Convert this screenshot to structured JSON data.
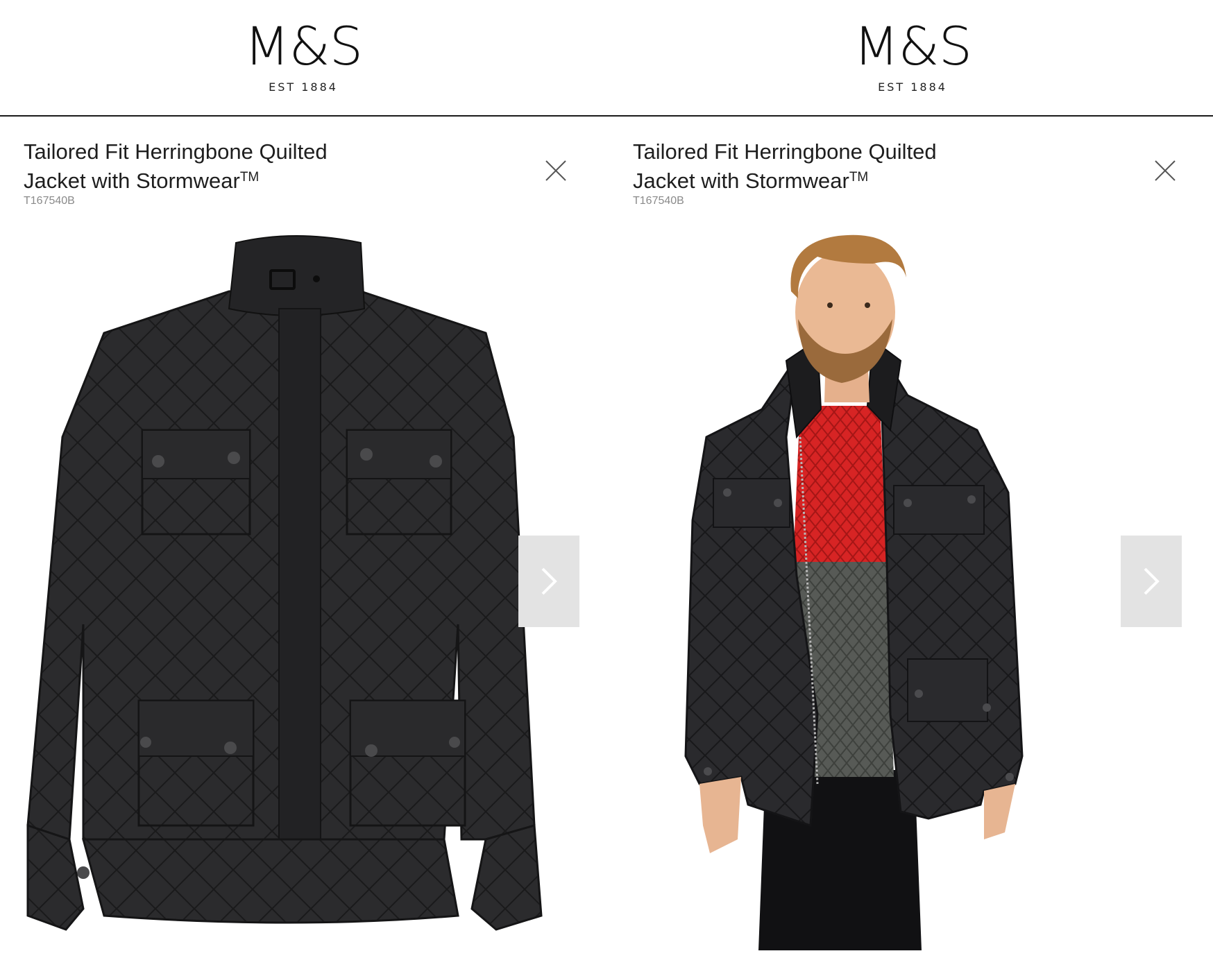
{
  "colors": {
    "background": "#ffffff",
    "text": "#1e1e1e",
    "sku_text": "#8a8a8a",
    "divider": "#1a1a1a",
    "next_button_bg": "#e3e3e3",
    "jacket": "#2a2a2c",
    "sweater_red": "#d42323",
    "sweater_grey": "#5b5e5a"
  },
  "panels": [
    {
      "logo": {
        "main": "M&S",
        "sub": "EST 1884"
      },
      "product": {
        "title_line1": "Tailored Fit Herringbone Quilted",
        "title_line2": "Jacket with Stormwear",
        "trademark": "TM",
        "sku": "T167540B"
      },
      "image": "jacket-flat-lay",
      "close_icon": "close-icon",
      "next_icon": "chevron-right-icon"
    },
    {
      "logo": {
        "main": "M&S",
        "sub": "EST 1884"
      },
      "product": {
        "title_line1": "Tailored Fit Herringbone Quilted",
        "title_line2": "Jacket with Stormwear",
        "trademark": "TM",
        "sku": "T167540B"
      },
      "image": "model-wearing-jacket",
      "close_icon": "close-icon",
      "next_icon": "chevron-right-icon"
    }
  ]
}
